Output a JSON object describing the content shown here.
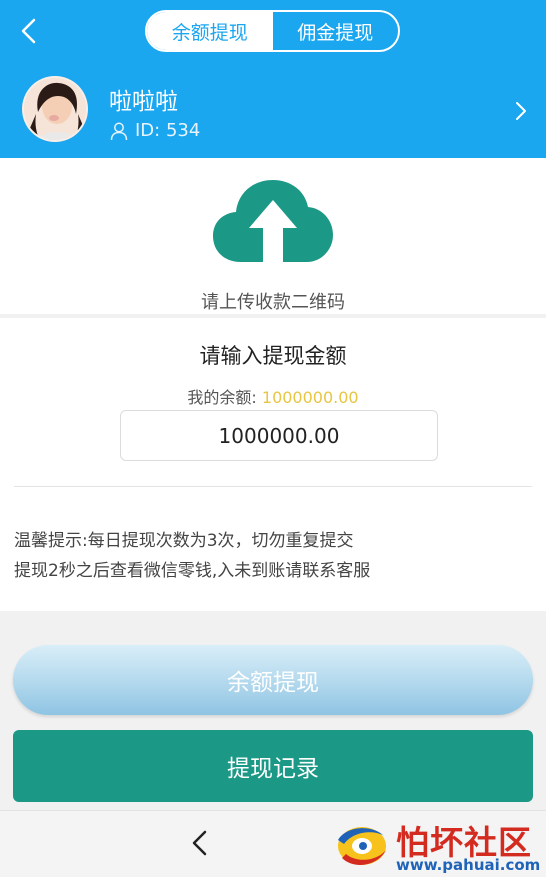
{
  "header": {
    "tabs": [
      {
        "label": "余额提现",
        "active": true
      },
      {
        "label": "佣金提现",
        "active": false
      }
    ]
  },
  "profile": {
    "name": "啦啦啦",
    "id_text": "ID: 534"
  },
  "upload": {
    "label": "请上传收款二维码"
  },
  "amount": {
    "title": "请输入提现金额",
    "balance_label": "我的余额:",
    "balance_value": "1000000.00",
    "input_value": "1000000.00"
  },
  "tip": {
    "line1": "温馨提示:每日提现次数为3次，切勿重复提交",
    "line2": "提现2秒之后查看微信零钱,入未到账请联系客服"
  },
  "actions": {
    "withdraw_label": "余额提现",
    "records_label": "提现记录"
  },
  "watermark": {
    "title": "怕坏社区",
    "url": "www.pahuai.com"
  },
  "colors": {
    "header": "#1ba6f0",
    "accent_teal": "#1b9986",
    "balance_value": "#e8c542"
  },
  "icons": [
    "back-arrow-icon",
    "user-icon",
    "chevron-right-icon",
    "cloud-upload-icon",
    "nav-back-icon"
  ]
}
